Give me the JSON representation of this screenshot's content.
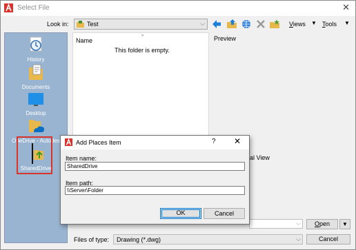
{
  "window": {
    "title": "Select File",
    "close_glyph": "✕"
  },
  "toolbar": {
    "look_in_label": "Look in:",
    "look_in_value": "Test",
    "views_label_u": "V",
    "views_label_rest": "iews",
    "tools_label_u": "T",
    "tools_label_rest": "ools",
    "icons": [
      "back-arrow-icon",
      "up-folder-icon",
      "search-web-icon",
      "delete-icon",
      "create-folder-icon"
    ]
  },
  "places": [
    {
      "label": "History",
      "icon": "history-icon"
    },
    {
      "label": "Documents",
      "icon": "documents-icon"
    },
    {
      "label": "Desktop",
      "icon": "desktop-icon"
    },
    {
      "label": "OneDrive - Autodes",
      "icon": "onedrive-icon"
    },
    {
      "label": "SharedDrive",
      "icon": "shared-drive-icon"
    }
  ],
  "filelist": {
    "name_header": "Name",
    "sort_glyph": "^",
    "empty_text": "This folder is empty."
  },
  "preview": {
    "label": "Preview",
    "partial_view_fragment": "ial View"
  },
  "bottom": {
    "files_of_type_label": "Files of type:",
    "files_of_type_value": "Drawing (*.dwg)",
    "open_label_u": "O",
    "open_label_rest": "pen",
    "cancel_label": "Cancel"
  },
  "dialog": {
    "title": "Add Places Item",
    "help_glyph": "?",
    "close_glyph": "✕",
    "item_name_label": "Item name:",
    "item_name_value": "SharedDrive",
    "item_path_label": "Item path:",
    "item_path_value": "\\\\Server\\Folder",
    "ok_label": "OK",
    "cancel_label": "Cancel"
  },
  "colors": {
    "autocad_red": "#d9332b",
    "places_bg": "#99b4d1",
    "highlight_box": "#d9332b"
  }
}
